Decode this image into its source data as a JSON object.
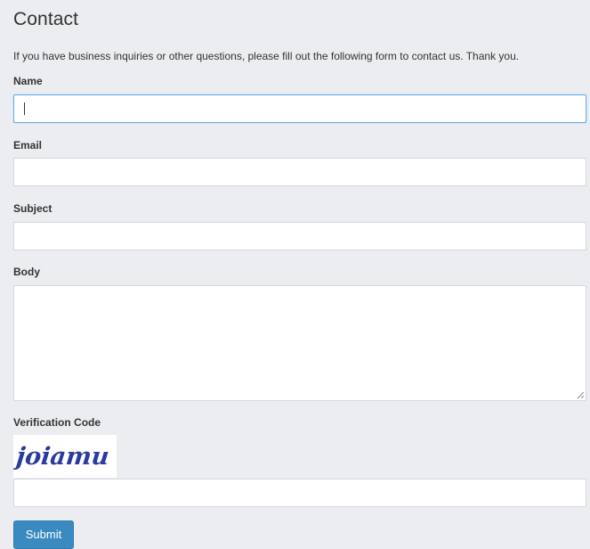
{
  "page": {
    "title": "Contact",
    "intro": "If you have business inquiries or other questions, please fill out the following form to contact us. Thank you."
  },
  "form": {
    "name_label": "Name",
    "name_value": "",
    "email_label": "Email",
    "email_value": "",
    "subject_label": "Subject",
    "subject_value": "",
    "body_label": "Body",
    "body_value": "",
    "verification_label": "Verification Code",
    "captcha_text": "joiamu",
    "verification_value": "",
    "submit_label": "Submit"
  },
  "colors": {
    "page_background": "#ebedf1",
    "submit_button": "#3a8ac1",
    "focus_border": "#66afe9",
    "captcha_ink": "#2a3a9e"
  }
}
